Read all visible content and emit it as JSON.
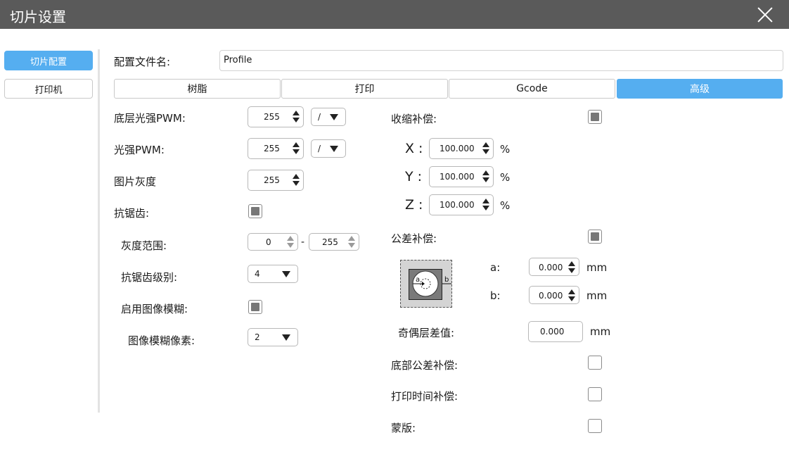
{
  "window": {
    "title": "切片设置"
  },
  "sidebar": {
    "items": [
      {
        "label": "切片配置",
        "active": true
      },
      {
        "label": "打印机",
        "active": false
      }
    ]
  },
  "profile": {
    "label": "配置文件名:",
    "value": "Profile"
  },
  "tabs": [
    {
      "label": "树脂",
      "active": false
    },
    {
      "label": "打印",
      "active": false
    },
    {
      "label": "Gcode",
      "active": false
    },
    {
      "label": "高级",
      "active": true
    }
  ],
  "left": {
    "bottom_pwm": {
      "label": "底层光强PWM:",
      "value": "255",
      "unit": "/"
    },
    "pwm": {
      "label": "光强PWM:",
      "value": "255",
      "unit": "/"
    },
    "gray": {
      "label": "图片灰度",
      "value": "255"
    },
    "antialias": {
      "label": "抗锯齿:",
      "checked": true
    },
    "gray_range": {
      "label": "灰度范围:",
      "min": "0",
      "sep": "-",
      "max": "255"
    },
    "aa_level": {
      "label": "抗锯齿级别:",
      "value": "4"
    },
    "blur": {
      "label": "启用图像模糊:",
      "checked": true
    },
    "blur_px": {
      "label": "图像模糊像素:",
      "value": "2"
    }
  },
  "right": {
    "shrink": {
      "label": "收缩补偿:",
      "checked": true
    },
    "x": {
      "label": "X :",
      "value": "100.000",
      "unit": "%"
    },
    "y": {
      "label": "Y :",
      "value": "100.000",
      "unit": "%"
    },
    "z": {
      "label": "Z :",
      "value": "100.000",
      "unit": "%"
    },
    "tolerance": {
      "label": "公差补偿:",
      "checked": true
    },
    "diagram": {
      "a": "a",
      "b": "b"
    },
    "a": {
      "label": "a:",
      "value": "0.000",
      "unit": "mm"
    },
    "b": {
      "label": "b:",
      "value": "0.000",
      "unit": "mm"
    },
    "odd_even": {
      "label": "奇偶层差值:",
      "value": "0.000",
      "unit": "mm"
    },
    "bottom_tol": {
      "label": "底部公差补偿:",
      "checked": false
    },
    "time_comp": {
      "label": "打印时间补偿:",
      "checked": false
    },
    "mask": {
      "label": "蒙版:",
      "checked": false
    }
  }
}
